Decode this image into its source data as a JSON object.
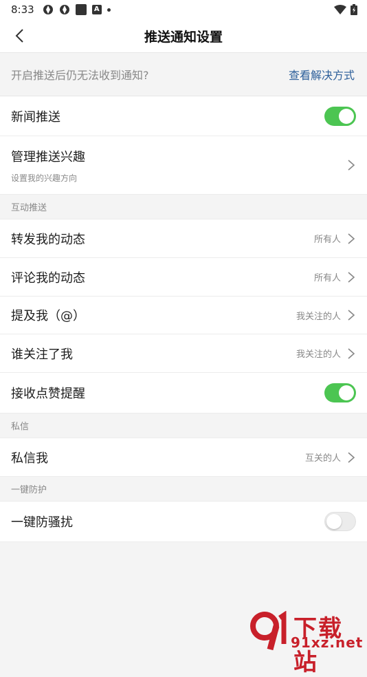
{
  "status_bar": {
    "time": "8:33"
  },
  "header": {
    "title": "推送通知设置"
  },
  "hint": {
    "text": "开启推送后仍无法收到通知?",
    "link": "查看解决方式"
  },
  "rows_top": [
    {
      "label": "新闻推送",
      "toggle": true
    },
    {
      "label": "管理推送兴趣",
      "sub": "设置我的兴趣方向"
    }
  ],
  "section_interact": "互动推送",
  "interact_rows": [
    {
      "label": "转发我的动态",
      "value": "所有人"
    },
    {
      "label": "评论我的动态",
      "value": "所有人"
    },
    {
      "label": "提及我（@）",
      "value": "我关注的人"
    },
    {
      "label": "谁关注了我",
      "value": "我关注的人"
    },
    {
      "label": "接收点赞提醒",
      "toggle": true
    }
  ],
  "section_dm": "私信",
  "dm_row": {
    "label": "私信我",
    "value": "互关的人"
  },
  "section_protect": "一键防护",
  "protect_row": {
    "label": "一键防骚扰",
    "toggle": false
  },
  "watermark": {
    "line1": "下载站",
    "line2": "91xz.net"
  },
  "colors": {
    "accent_green": "#4cc552",
    "link_blue": "#2d5f9a",
    "watermark_red": "#c8202a"
  }
}
